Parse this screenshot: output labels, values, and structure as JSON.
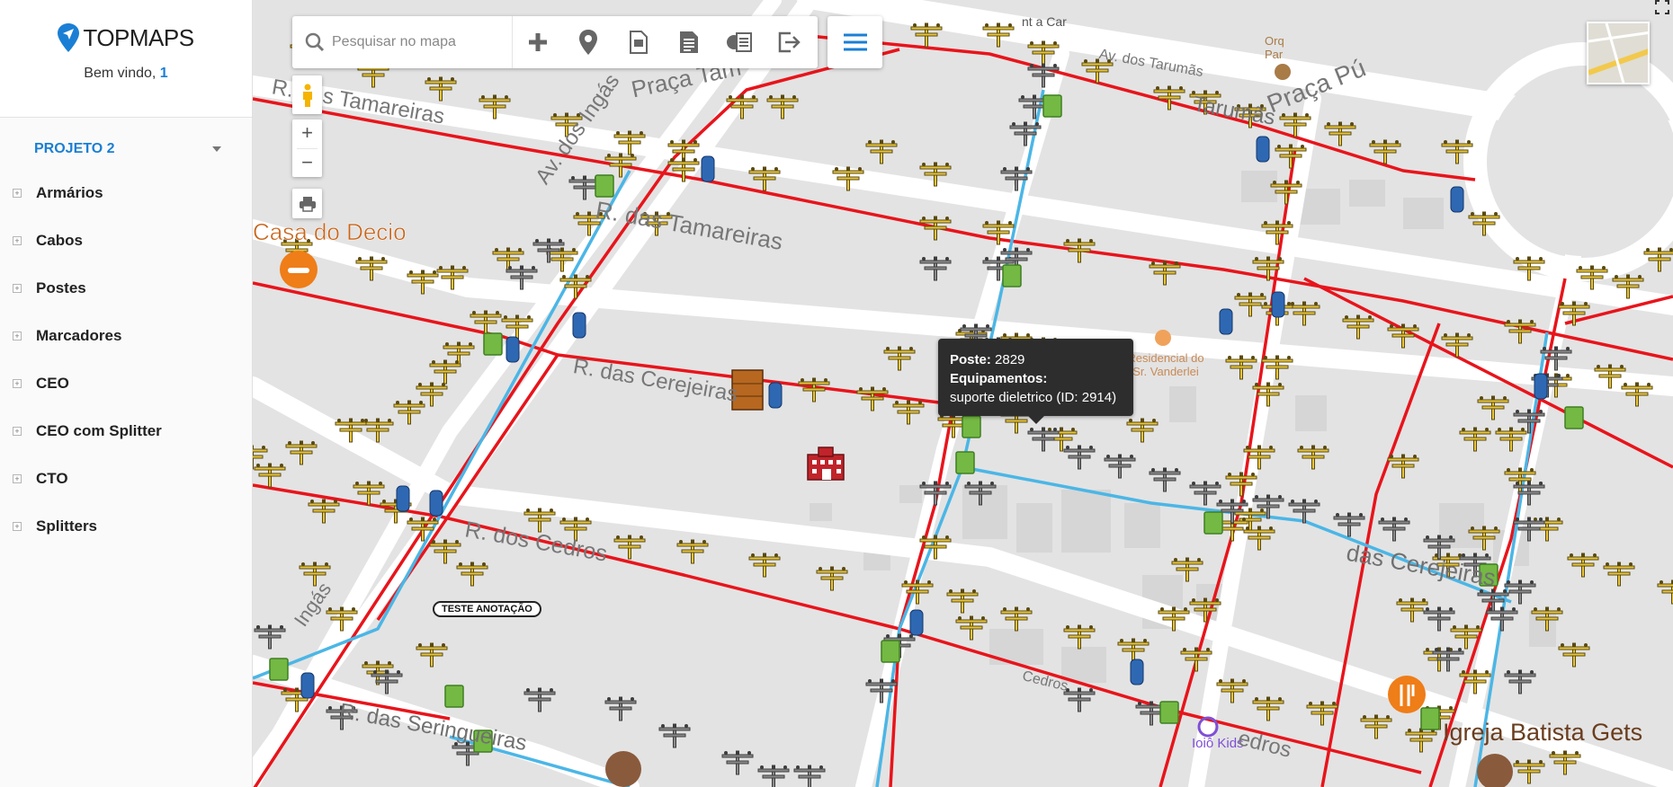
{
  "app": {
    "name": "TOPMAPS",
    "welcome": "Bem vindo,",
    "user": "1"
  },
  "project": {
    "name": "PROJETO 2"
  },
  "layers": [
    {
      "label": "Armários"
    },
    {
      "label": "Cabos"
    },
    {
      "label": "Postes"
    },
    {
      "label": "Marcadores"
    },
    {
      "label": "CEO"
    },
    {
      "label": "CEO com Splitter"
    },
    {
      "label": "CTO"
    },
    {
      "label": "Splitters"
    }
  ],
  "search": {
    "placeholder": "Pesquisar no mapa"
  },
  "toolbar": {
    "icons": [
      "plus-icon",
      "map-pin-icon",
      "document-icon",
      "report-icon",
      "import-icon",
      "logout-icon"
    ]
  },
  "map_controls": {
    "zoom_in": "+",
    "zoom_out": "−"
  },
  "tooltip": {
    "poste_label": "Poste:",
    "poste_value": "2829",
    "equip_label": "Equipamentos:",
    "equip_value": "suporte dieletrico (ID: 2914)"
  },
  "map_labels": {
    "casa": "Casa do Decio",
    "igreja": "Igreja Batista Gets",
    "ioio": "Ioiô Kids",
    "residencial": "Residencial do Sr. Vanderlei",
    "annotation": "TESTE ANOTAÇÃO",
    "car": "nt a Car",
    "orq": "Orq Par",
    "street_tamaruns": "Av. dos Tarumãs",
    "street_tamaruns2": "Tarumãs",
    "street_praca_pub": "Praça Pú",
    "street_praca_tam": "Praça Tam",
    "street_ingas": "Av. dos Ingás",
    "street_tamareiras_w": "R. das Tamareiras",
    "street_tamareiras": "R. das Tamareiras",
    "street_cerejeiras": "R. das Cerejeiras",
    "street_cerejeiras_e": "das Cerejeiras",
    "street_cedros": "R. dos Cedros",
    "street_cedros_e": "Cedros",
    "street_cedros_e2": "edros",
    "street_seringueiras": "R. das Seringueiras",
    "street_ingas_s": "Ingás"
  },
  "colors": {
    "accent": "#1a7fd4",
    "cable_red": "#e8141b",
    "cable_blue": "#4bb6e6",
    "pole_yellow": "#e8c53a",
    "pole_gray": "#8a8a8a"
  }
}
